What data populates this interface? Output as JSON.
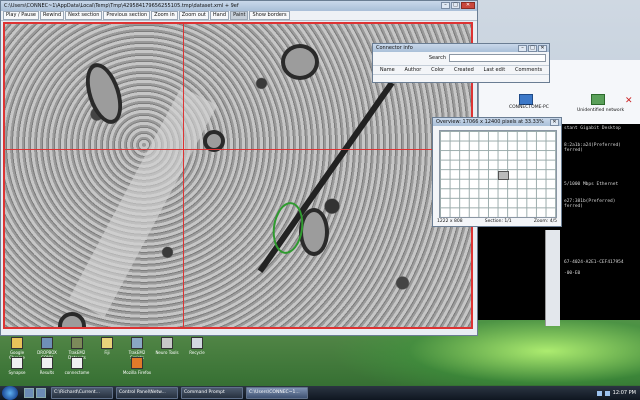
{
  "viewer": {
    "title": "C:\\Users\\CONNEC~1\\AppData\\Local\\Temp\\Tmp\\429584179656255105.tmp\\dataset.xml + 9ef",
    "toolbar": [
      "Play / Pause",
      "Rewind",
      "Next section",
      "Previous section",
      "Zoom in",
      "Zoom out",
      "Hand",
      "Paint",
      "Show borders"
    ]
  },
  "connector_info": {
    "title": "Connector info",
    "search_label": "Search",
    "columns": [
      "Name",
      "Author",
      "Color",
      "Created",
      "Last edit",
      "Comments"
    ]
  },
  "overview": {
    "title": "Overview: 17066 x 12400 pixels at 33.33%",
    "status_left": "1222 x 808",
    "status_section": "Section: 1/1",
    "status_zoom": "Zoom: 4/5"
  },
  "network": {
    "node1": "CONNECTOME-PC",
    "node2": "Unidentified network"
  },
  "cmd": {
    "lines_left": [
      "",
      "",
      "",
      "",
      "",
      "",
      "",
      "",
      "",
      "",
      "",
      "",
      "",
      "",
      "",
      "",
      "",
      "",
      "",
      "",
      "",
      "",
      "",
      "",
      "",
      "",
      "",
      "",
      "",
      "",
      ""
    ],
    "lines_right": [
      "stant Gigabit Desktop",
      "",
      "",
      "8:2a1b:a24(Preferred)",
      "ferred)",
      "",
      "",
      "",
      "",
      "",
      "5/1000 Mbps Ethernet",
      "",
      "",
      "e27:381b(Preferred)",
      "ferred)",
      "",
      "",
      "",
      "",
      "",
      "",
      "",
      "",
      "",
      "67-4024-A2E1-CEF417954",
      "",
      "-00-E0",
      "",
      ""
    ]
  },
  "desktop_icons": [
    {
      "label": "Google Chrome"
    },
    {
      "label": "DROPBOX CONN"
    },
    {
      "label": "TrakEM2 Datasets"
    },
    {
      "label": "Fiji"
    },
    {
      "label": "TrakEM2 Scripts"
    },
    {
      "label": "Neuro Tools"
    },
    {
      "label": "Recycle"
    },
    {
      "label": "Synapse"
    },
    {
      "label": "Results"
    },
    {
      "label": "connectome"
    },
    {
      "label": "Mozilla Firefox"
    }
  ],
  "taskbar": {
    "tasks": [
      "C:\\Richard\\Current...",
      "Control Panel\\Netw...",
      "Command Prompt",
      "C:\\Users\\CONNEC~1..."
    ],
    "active_index": 3,
    "clock": "12:07 PM"
  }
}
